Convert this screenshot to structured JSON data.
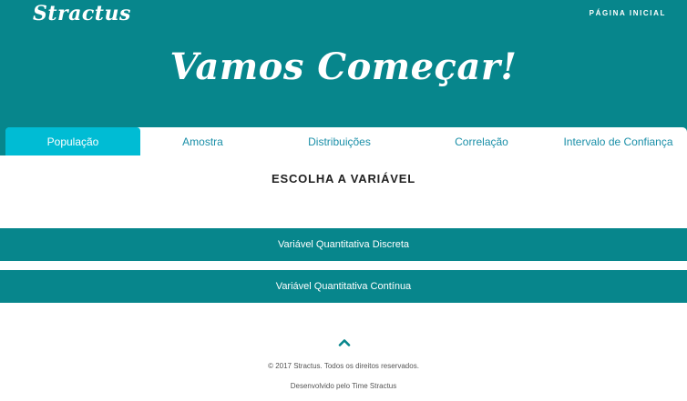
{
  "header": {
    "brand": "Stractus",
    "nav_home": "PÁGINA INICIAL",
    "title": "Vamos Começar!"
  },
  "tabs": [
    {
      "label": "População",
      "active": true
    },
    {
      "label": "Amostra",
      "active": false
    },
    {
      "label": "Distribuições",
      "active": false
    },
    {
      "label": "Correlação",
      "active": false
    },
    {
      "label": "Intervalo de Confiança",
      "active": false
    }
  ],
  "main": {
    "section_title": "ESCOLHA A VARIÁVEL",
    "options": [
      {
        "label": "Variável Quantitativa Discreta"
      },
      {
        "label": "Variável Quantitativa Contínua"
      }
    ]
  },
  "footer": {
    "scroll_top_icon": "chevron-up-icon",
    "copyright": "© 2017 Stractus. Todos os direitos reservados.",
    "developed_by": "Desenvolvido pelo Time Stractus"
  },
  "colors": {
    "primary": "#07868c",
    "active_tab": "#00bcd4",
    "tab_text": "#1a8fa8"
  }
}
